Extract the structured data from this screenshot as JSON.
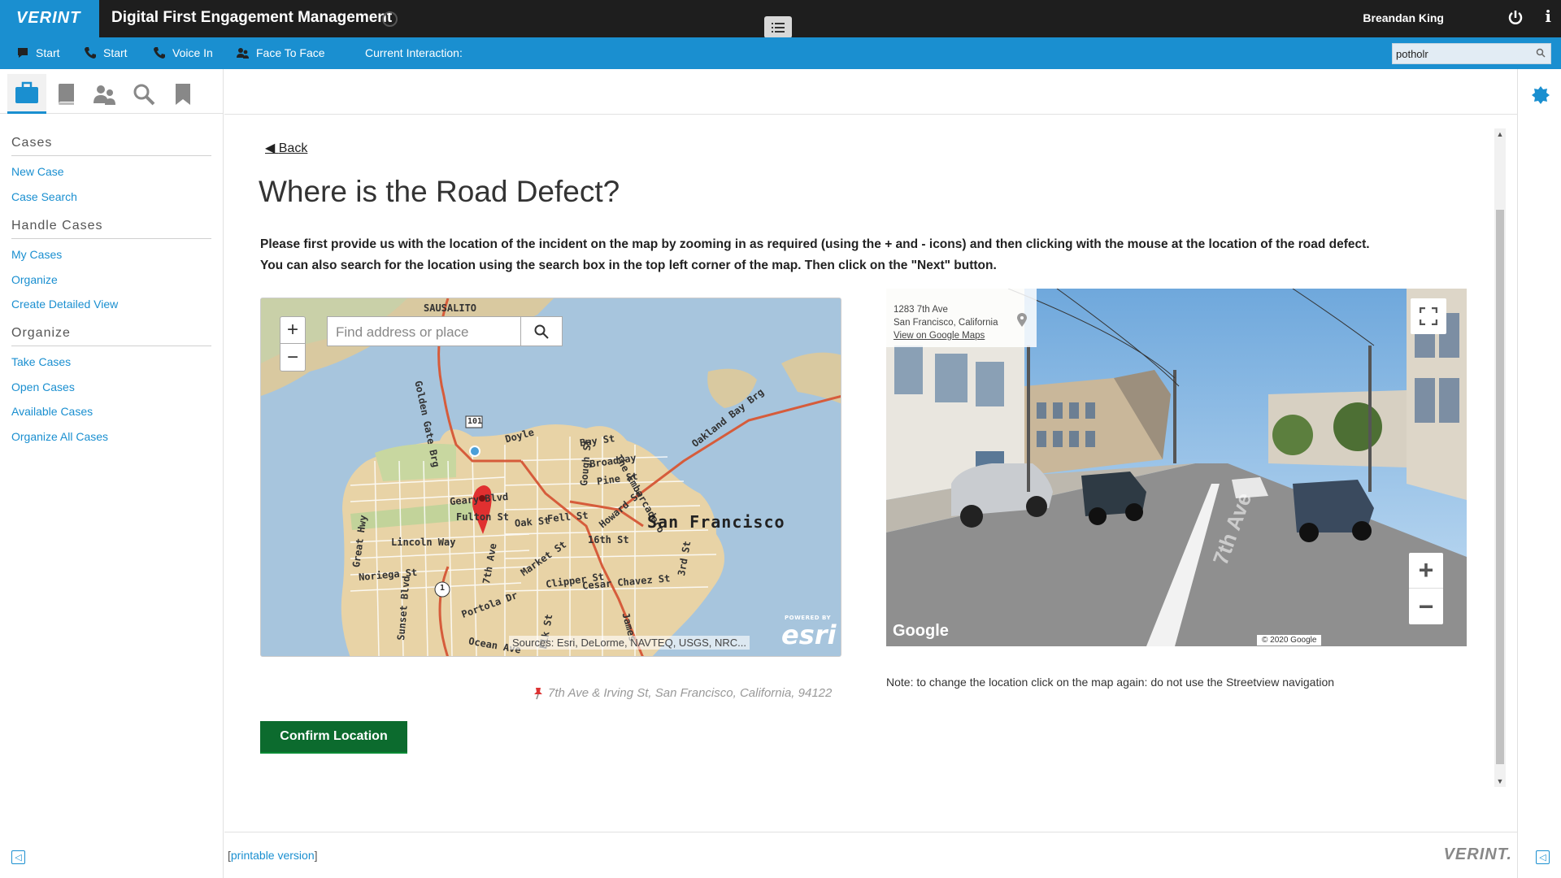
{
  "app": {
    "logo": "VERINT",
    "title": "Digital First Engagement Management",
    "user": "Breandan King"
  },
  "actionbar": {
    "items": [
      {
        "label": "Start",
        "icon": "chat-icon"
      },
      {
        "label": "Start",
        "icon": "phone-icon"
      },
      {
        "label": "Voice In",
        "icon": "phone-icon"
      },
      {
        "label": "Face To Face",
        "icon": "people-icon"
      }
    ],
    "current_interaction": "Current Interaction:",
    "search_value": "potholr"
  },
  "sidebar": {
    "tabs": [
      "briefcase-icon",
      "book-icon",
      "users-icon",
      "search-icon",
      "bookmark-icon"
    ],
    "sections": [
      {
        "title": "Cases",
        "links": [
          "New Case",
          "Case Search"
        ]
      },
      {
        "title": "Handle Cases",
        "links": [
          "My Cases",
          "Organize",
          "Create Detailed View"
        ]
      },
      {
        "title": "Organize",
        "links": [
          "Take Cases",
          "Open Cases",
          "Available Cases",
          "Organize All Cases"
        ]
      }
    ]
  },
  "main": {
    "back": "Back",
    "title": "Where is the Road Defect?",
    "instructions_line1": "Please first provide us with the location of the incident on the map by zooming in as required (using the + and - icons) and then clicking with the mouse at the location of the road defect.",
    "instructions_line2": " You can also search for the location using the search box in the top left corner of the map. Then click on the \"Next\" button.",
    "map": {
      "search_placeholder": "Find address or place",
      "city_label": "San Francisco",
      "labels": [
        "SAUSALITO",
        "Golden Gate Brg",
        "Doyle",
        "Bay St",
        "Broadway",
        "Pine St",
        "Geary Blvd",
        "Fulton St",
        "Oak St",
        "Fell St",
        "Howard St",
        "The Embarcadero",
        "Oakland Bay Brg",
        "Lincoln Way",
        "Noriega St",
        "Great Hwy",
        "Sunset Blvd",
        "7th Ave",
        "Market St",
        "16th St",
        "3rd St",
        "Clipper St",
        "Cesar Chavez St",
        "Portola Dr",
        "Ocean Ave",
        "James",
        "Gough St",
        "Elk St",
        "101",
        "1"
      ],
      "attribution": "Sources: Esri, DeLorme, NAVTEQ, USGS, NRC...",
      "powered_by": "POWERED BY",
      "esri": "esri"
    },
    "address": "7th Ave & Irving St, San Francisco, California, 94122",
    "confirm_label": "Confirm Location",
    "streetview": {
      "address_line1": "1283 7th Ave",
      "address_line2": "San Francisco, California",
      "link": "View on Google Maps",
      "google": "Google",
      "copyright": "© 2020 Google",
      "road_text": "7th Ave"
    },
    "note": "Note: to change the location click on the map again:  do not use the Streetview navigation"
  },
  "footer": {
    "printable_open": "[",
    "printable": "printable version",
    "printable_close": "]",
    "logo": "VERINT."
  }
}
